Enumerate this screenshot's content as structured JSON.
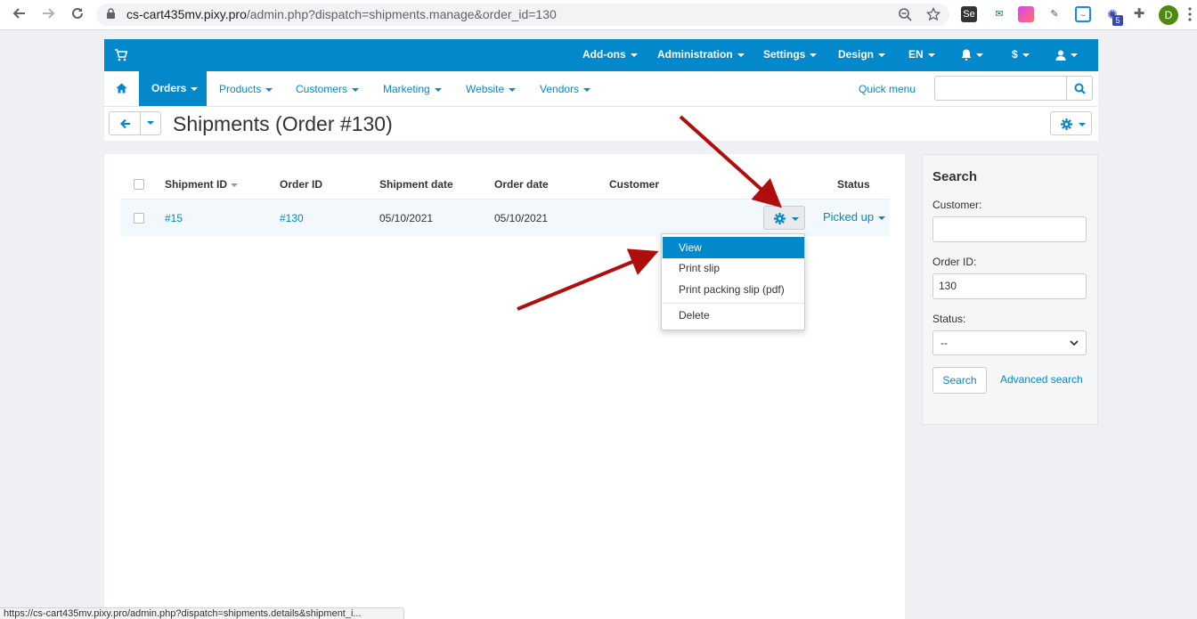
{
  "browser": {
    "url_host": "cs-cart435mv.pixy.pro",
    "url_path": "/admin.php?dispatch=shipments.manage&order_id=130",
    "profile_initial": "D",
    "extension_badge": "5",
    "status_url": "https://cs-cart435mv.pixy.pro/admin.php?dispatch=shipments.details&shipment_i..."
  },
  "topbar": {
    "menus": [
      "Add-ons",
      "Administration",
      "Settings",
      "Design",
      "EN",
      "$"
    ]
  },
  "navbar": {
    "items": [
      "Orders",
      "Products",
      "Customers",
      "Marketing",
      "Website",
      "Vendors"
    ],
    "quick_menu": "Quick menu"
  },
  "page": {
    "title": "Shipments (Order #130)"
  },
  "table": {
    "headers": [
      "Shipment ID",
      "Order ID",
      "Shipment date",
      "Order date",
      "Customer",
      "Status"
    ],
    "rows": [
      {
        "shipment_id": "#15",
        "order_id": "#130",
        "shipment_date": "05/10/2021",
        "order_date": "05/10/2021",
        "customer": "",
        "status": "Picked up"
      }
    ]
  },
  "dropdown": {
    "items": [
      "View",
      "Print slip",
      "Print packing slip (pdf)",
      "Delete"
    ],
    "active": "View"
  },
  "sidebar": {
    "title": "Search",
    "customer_label": "Customer:",
    "customer_value": "",
    "order_id_label": "Order ID:",
    "order_id_value": "130",
    "status_label": "Status:",
    "status_value": "--",
    "search_button": "Search",
    "advanced_search": "Advanced search"
  },
  "colors": {
    "primary": "#0388cc",
    "annotation_arrow": "#b00d0d"
  }
}
